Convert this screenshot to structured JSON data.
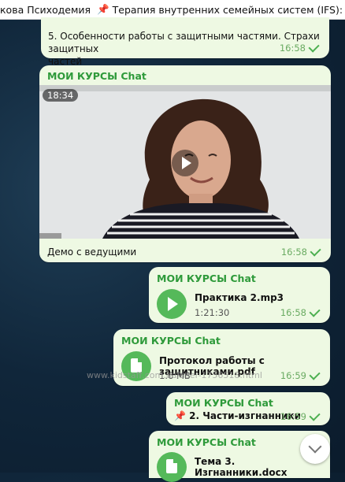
{
  "header": {
    "channel": "кова Психодемия",
    "pin_emoji": "📌",
    "title": "Терапия внутренних семейных систем (IFS): расширен..."
  },
  "messages": {
    "m1": {
      "line1": "5. Особенности работы с защитными частями. Страхи защитных",
      "line2": "частей",
      "time": "16:58"
    },
    "m2": {
      "sender": "МОИ КУРСЫ Chat",
      "duration": "18:34",
      "caption": "Демо с ведущими",
      "time": "16:58"
    },
    "m3": {
      "sender": "МОИ КУРСЫ Chat",
      "file": "Практика 2.mp3",
      "sub": "1:21:30",
      "time": "16:58"
    },
    "m4": {
      "sender": "МОИ КУРСЫ Chat",
      "file": "Протокол работы с защитниками.pdf",
      "sub": "1.6 MB",
      "time": "16:59"
    },
    "m5": {
      "sender": "МОИ КУРСЫ Chat",
      "pin": "📌",
      "text": "2. Части-изгнанники",
      "time": "16:59"
    },
    "m6": {
      "sender": "МОИ КУРСЫ Chat",
      "file": "Тема 3. Изгнанники.docx"
    }
  },
  "watermark": "www.kidstaff.com.ua/user-1756518.html"
}
